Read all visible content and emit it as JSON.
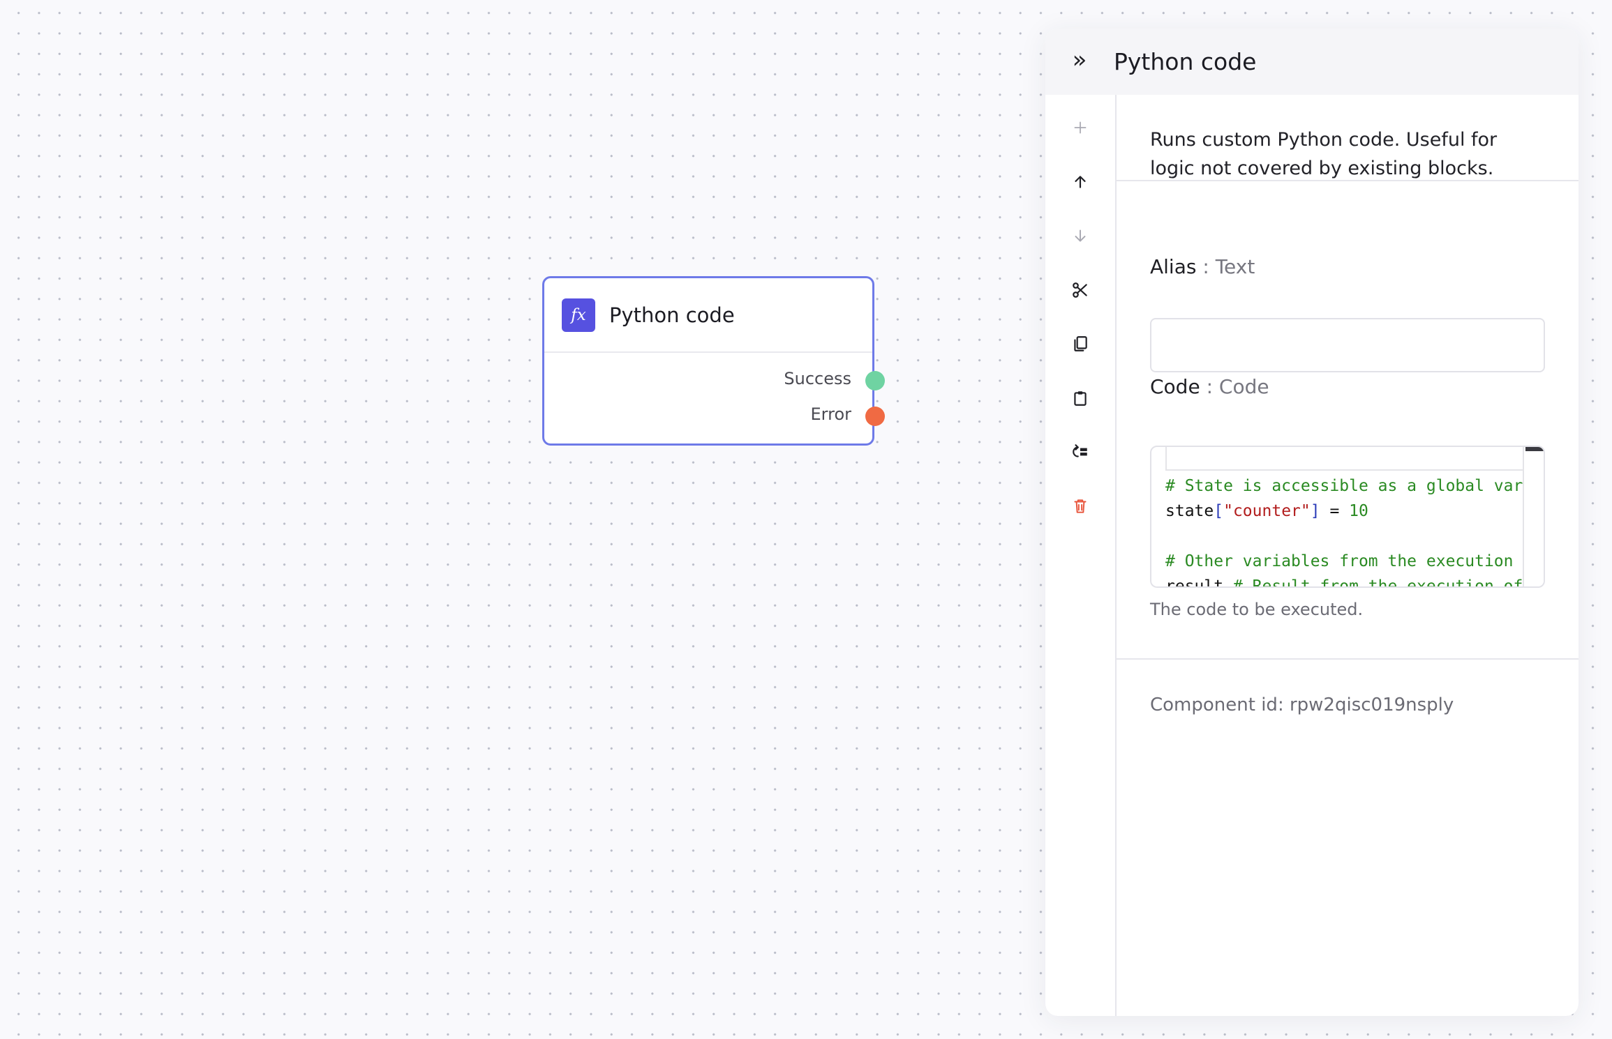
{
  "node": {
    "icon": "fx",
    "title": "Python code",
    "outputs": {
      "success": "Success",
      "error": "Error"
    }
  },
  "panel": {
    "title": "Python code",
    "collapse_icon": "»",
    "description": "Runs custom Python code. Useful for logic not covered by existing blocks.",
    "toolbar": [
      "add-icon",
      "arrow-up-icon",
      "arrow-down-icon",
      "cut-icon",
      "copy-icon",
      "paste-icon",
      "go-to-icon",
      "delete-icon"
    ],
    "alias": {
      "label": "Alias",
      "separator": " : ",
      "type": "Text",
      "value": ""
    },
    "code": {
      "label": "Code",
      "separator": " : ",
      "type": "Code",
      "lines": {
        "l1": "# State is accessible as a global vari",
        "l2a": "state",
        "l2b": "[",
        "l2c": "\"counter\"",
        "l2d": "]",
        "l2e": " = ",
        "l2f": "10",
        "l4": "# Other variables from the execution e",
        "l5a": "result ",
        "l5b": "# Result from the execution of"
      },
      "help": "The code to be executed."
    },
    "component_id": "Component id: rpw2qisc019nsply"
  },
  "colors": {
    "accent": "#5651e0",
    "node_border": "#6e7ae8",
    "success": "#6fd3a2",
    "error": "#f06a43",
    "delete": "#e8543b"
  }
}
